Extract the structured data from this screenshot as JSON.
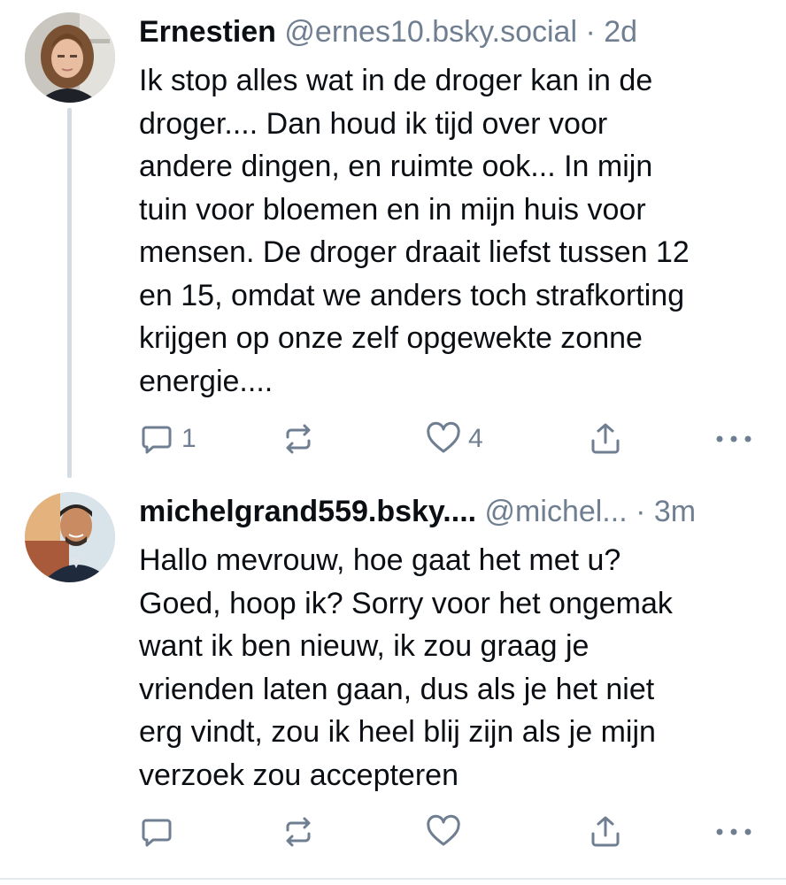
{
  "posts": [
    {
      "display_name": "Ernestien",
      "handle": "@ernes10.bsky.social",
      "separator": "·",
      "time": "2d",
      "lines": [
        "Ik stop alles wat in de droger kan in de",
        "droger.... Dan houd ik tijd over voor",
        "andere dingen, en ruimte ook... In mijn",
        "tuin voor bloemen en in mijn huis voor",
        "mensen. De droger draait liefst tussen 12",
        "en 15, omdat we anders toch strafkorting",
        "krijgen op onze zelf opgewekte zonne",
        "energie...."
      ],
      "reply_count": "1",
      "like_count": "4"
    },
    {
      "display_name": "michelgrand559.bsky....",
      "handle": "@michel...",
      "separator": "·",
      "time": "3m",
      "lines": [
        "Hallo mevrouw, hoe gaat het met u?",
        "Goed, hoop ik? Sorry voor het ongemak",
        "want ik ben nieuw, ik zou graag je",
        "vrienden laten gaan, dus als je het niet",
        "erg vindt, zou ik heel blij zijn als je mijn",
        "verzoek zou accepteren"
      ],
      "reply_count": "",
      "like_count": ""
    }
  ],
  "icons": {
    "reply": "speech-bubble-icon",
    "repost": "repost-arrows-icon",
    "like": "heart-outline-icon",
    "share": "share-upload-icon",
    "more": "more-dots-icon"
  },
  "colors": {
    "text": "#0b0f14",
    "muted": "#6f7f91",
    "thread_line": "#d4dbe2"
  }
}
